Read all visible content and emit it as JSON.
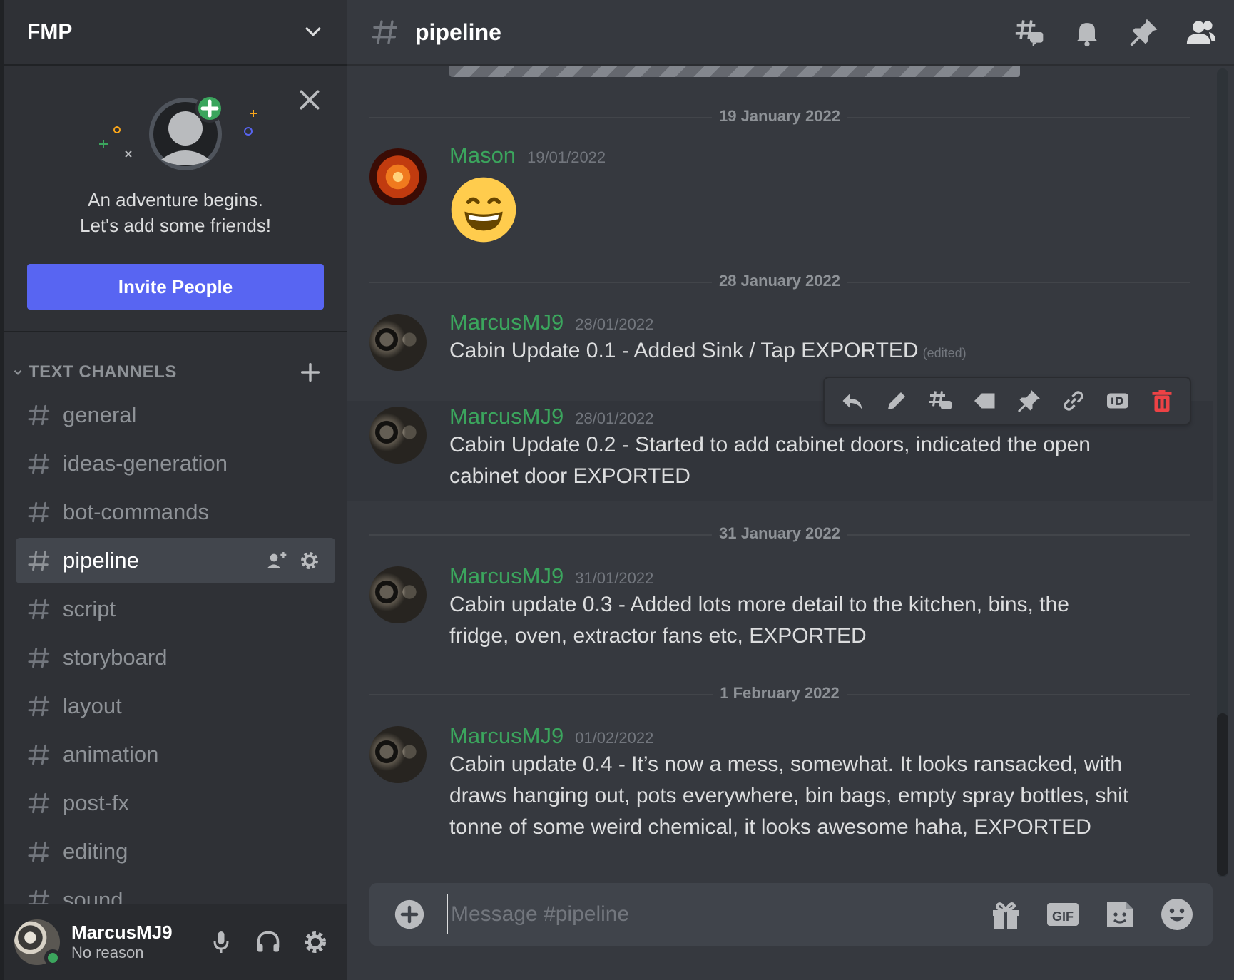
{
  "server": {
    "name": "FMP"
  },
  "invite": {
    "line1": "An adventure begins.",
    "line2": "Let's add some friends!",
    "button": "Invite People"
  },
  "category": {
    "label": "TEXT CHANNELS"
  },
  "channels": [
    {
      "name": "general"
    },
    {
      "name": "ideas-generation"
    },
    {
      "name": "bot-commands"
    },
    {
      "name": "pipeline",
      "active": true
    },
    {
      "name": "script"
    },
    {
      "name": "storyboard"
    },
    {
      "name": "layout"
    },
    {
      "name": "animation"
    },
    {
      "name": "post-fx"
    },
    {
      "name": "editing"
    },
    {
      "name": "sound"
    }
  ],
  "user": {
    "name": "MarcusMJ9",
    "status": "No reason"
  },
  "header": {
    "channel": "pipeline"
  },
  "dividers": [
    "19 January 2022",
    "28 January 2022",
    "31 January 2022",
    "1 February 2022"
  ],
  "messages": [
    {
      "author": "Mason",
      "timestamp": "19/01/2022",
      "emoji": "grinning-face"
    },
    {
      "author": "MarcusMJ9",
      "timestamp": "28/01/2022",
      "text": "Cabin Update 0.1  - Added Sink / Tap   EXPORTED",
      "edited": "(edited)"
    },
    {
      "author": "MarcusMJ9",
      "timestamp": "28/01/2022",
      "text": "Cabin Update 0.2 - Started to add cabinet doors, indicated the open cabinet door EXPORTED"
    },
    {
      "author": "MarcusMJ9",
      "timestamp": "31/01/2022",
      "text": "Cabin update 0.3 - Added lots more detail to the kitchen, bins, the fridge, oven, extractor fans etc, EXPORTED"
    },
    {
      "author": "MarcusMJ9",
      "timestamp": "01/02/2022",
      "text": "Cabin update 0.4 - It’s now a mess, somewhat. It looks ransacked, with draws hanging out, pots everywhere, bin bags, empty spray bottles, shit tonne of some weird chemical, it looks awesome haha, EXPORTED"
    }
  ],
  "composer": {
    "placeholder": "Message #pipeline"
  },
  "colors": {
    "accent": "#5865f2",
    "author": "#3ba55d",
    "danger": "#ed4245"
  }
}
